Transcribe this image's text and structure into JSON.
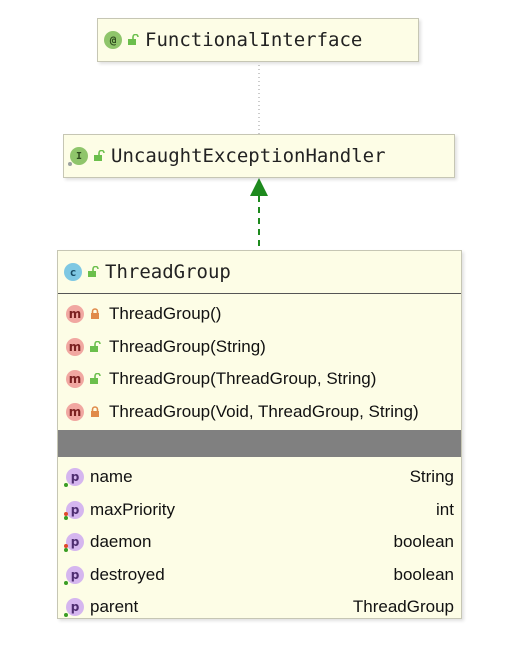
{
  "nodes": {
    "functional_interface": {
      "name": "FunctionalInterface",
      "badge": "@"
    },
    "uncaught_handler": {
      "name": "UncaughtExceptionHandler",
      "badge": "I"
    },
    "thread_group": {
      "name": "ThreadGroup",
      "badge": "c",
      "methods": [
        {
          "badge": "m",
          "label": "ThreadGroup()",
          "visibility": "private"
        },
        {
          "badge": "m",
          "label": "ThreadGroup(String)",
          "visibility": "public"
        },
        {
          "badge": "m",
          "label": "ThreadGroup(ThreadGroup, String)",
          "visibility": "public"
        },
        {
          "badge": "m",
          "label": "ThreadGroup(Void, ThreadGroup, String)",
          "visibility": "private"
        }
      ],
      "fields": [
        {
          "badge": "p",
          "name": "name",
          "type": "String"
        },
        {
          "badge": "p",
          "name": "maxPriority",
          "type": "int"
        },
        {
          "badge": "p",
          "name": "daemon",
          "type": "boolean"
        },
        {
          "badge": "p",
          "name": "destroyed",
          "type": "boolean"
        },
        {
          "badge": "p",
          "name": "parent",
          "type": "ThreadGroup"
        }
      ]
    }
  },
  "colors": {
    "node_fill": "#fdfde6",
    "implements_arrow": "#1e8a1e",
    "annotation_link": "#9a9a9a",
    "public_lock": "#6bbf4c",
    "private_lock": "#e08a4a"
  }
}
